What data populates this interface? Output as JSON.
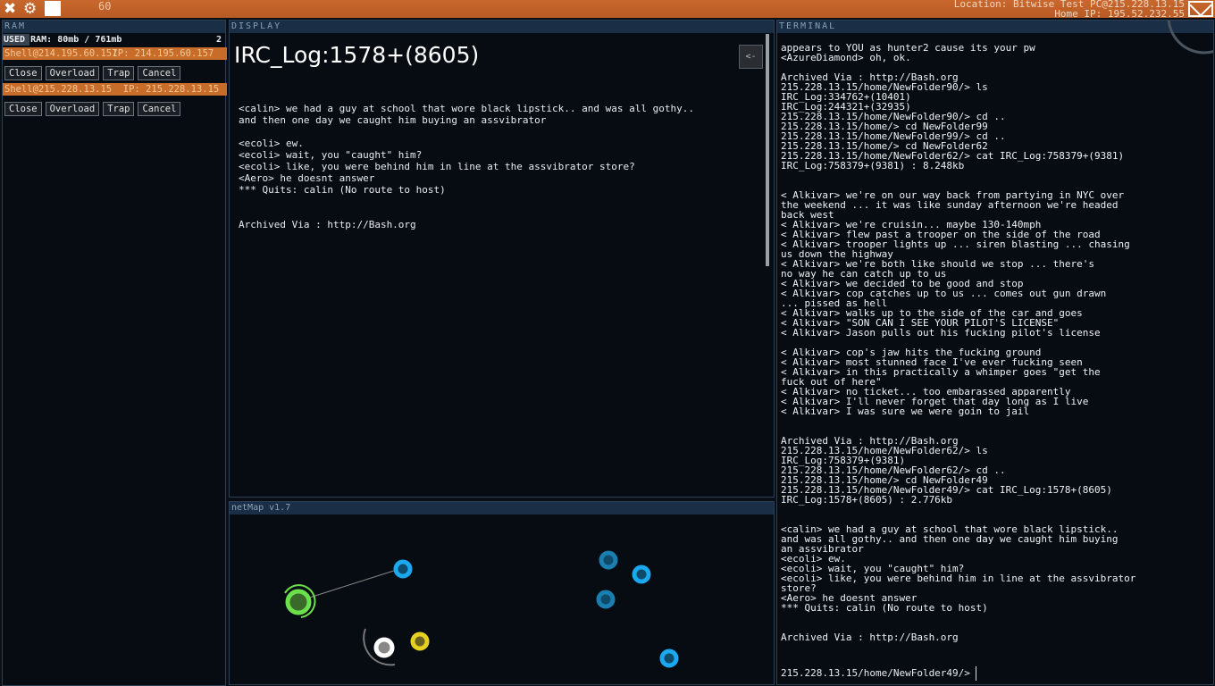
{
  "topbar": {
    "fps": "60",
    "location": "Location: Bitwise Test PC@215.228.13.15",
    "home_ip": "Home IP: 195.52.232.55"
  },
  "ram": {
    "header": "RAM",
    "used": "USED RAM: 80mb / 761mb",
    "count": "2",
    "shells": [
      {
        "label": "Shell@214.195.60.157",
        "ip": "IP: 214.195.60.157",
        "close": "Close",
        "overload": "Overload",
        "trap": "Trap",
        "cancel": "Cancel"
      },
      {
        "label": "Shell@215.228.13.15",
        "ip": "IP: 215.228.13.15",
        "close": "Close",
        "overload": "Overload",
        "trap": "Trap",
        "cancel": "Cancel"
      }
    ]
  },
  "display": {
    "header": "DISPLAY",
    "title": "IRC_Log:1578+(8605)",
    "back": "<-",
    "body": "<calin> we had a guy at school that wore black lipstick.. and was all gothy..\nand then one day we caught him buying an assvibrator\n\n<ecoli> ew.\n<ecoli> wait, you \"caught\" him?\n<ecoli> like, you were behind him in line at the assvibrator store?\n<Aero> he doesnt answer\n*** Quits: calin (No route to host)\n\n\nArchived Via : http://Bash.org"
  },
  "netmap": {
    "header": "netMap v1.7"
  },
  "terminal": {
    "header": "TERMINAL",
    "body": "appears to YOU as hunter2 cause its your pw\n<AzureDiamond> oh, ok.\n\nArchived Via : http://Bash.org\n215.228.13.15/home/NewFolder90/> ls\nIRC_Log:334762+(10401)\nIRC_Log:244321+(32935)\n215.228.13.15/home/NewFolder90/> cd ..\n215.228.13.15/home/> cd NewFolder99\n215.228.13.15/home/NewFolder99/> cd ..\n215.228.13.15/home/> cd NewFolder62\n215.228.13.15/home/NewFolder62/> cat IRC_Log:758379+(9381)\nIRC_Log:758379+(9381) : 8.248kb\n\n\n< Alkivar> we're on our way back from partying in NYC over\nthe weekend ... it was like sunday afternoon we're headed\nback west\n< Alkivar> we're cruisin... maybe 130-140mph\n< Alkivar> flew past a trooper on the side of the road\n< Alkivar> trooper lights up ... siren blasting ... chasing\nus down the highway\n< Alkivar> we're both like should we stop ... there's\nno way he can catch up to us\n< Alkivar> we decided to be good and stop\n< Alkivar> cop catches up to us ... comes out gun drawn\n... pissed as hell\n< Alkivar> walks up to the side of the car and goes\n< Alkivar> \"SON CAN I SEE YOUR PILOT'S LICENSE\"\n< Alkivar> Jason pulls out his fucking pilot's license\n\n< Alkivar> cop's jaw hits the fucking ground\n< Alkivar> most stunned face I've ever fucking seen\n< Alkivar> in this practically a whimper goes \"get the\nfuck out of here\"\n< Alkivar> no ticket... too embarassed apparently\n< Alkivar> I'll never forget that day long as I live\n< Alkivar> I was sure we were goin to jail\n\n\nArchived Via : http://Bash.org\n215.228.13.15/home/NewFolder62/> ls\nIRC_Log:758379+(9381)\n215.228.13.15/home/NewFolder62/> cd ..\n215.228.13.15/home/> cd NewFolder49\n215.228.13.15/home/NewFolder49/> cat IRC_Log:1578+(8605)\nIRC_Log:1578+(8605) : 2.776kb\n\n\n<calin> we had a guy at school that wore black lipstick..\nand was all gothy.. and then one day we caught him buying\nan assvibrator\n<ecoli> ew.\n<ecoli> wait, you \"caught\" him?\n<ecoli> like, you were behind him in line at the assvibrator\nstore?\n<Aero> he doesnt answer\n*** Quits: calin (No route to host)\n\n\nArchived Via : http://Bash.org",
    "prompt": "215.228.13.15/home/NewFolder49/>"
  }
}
